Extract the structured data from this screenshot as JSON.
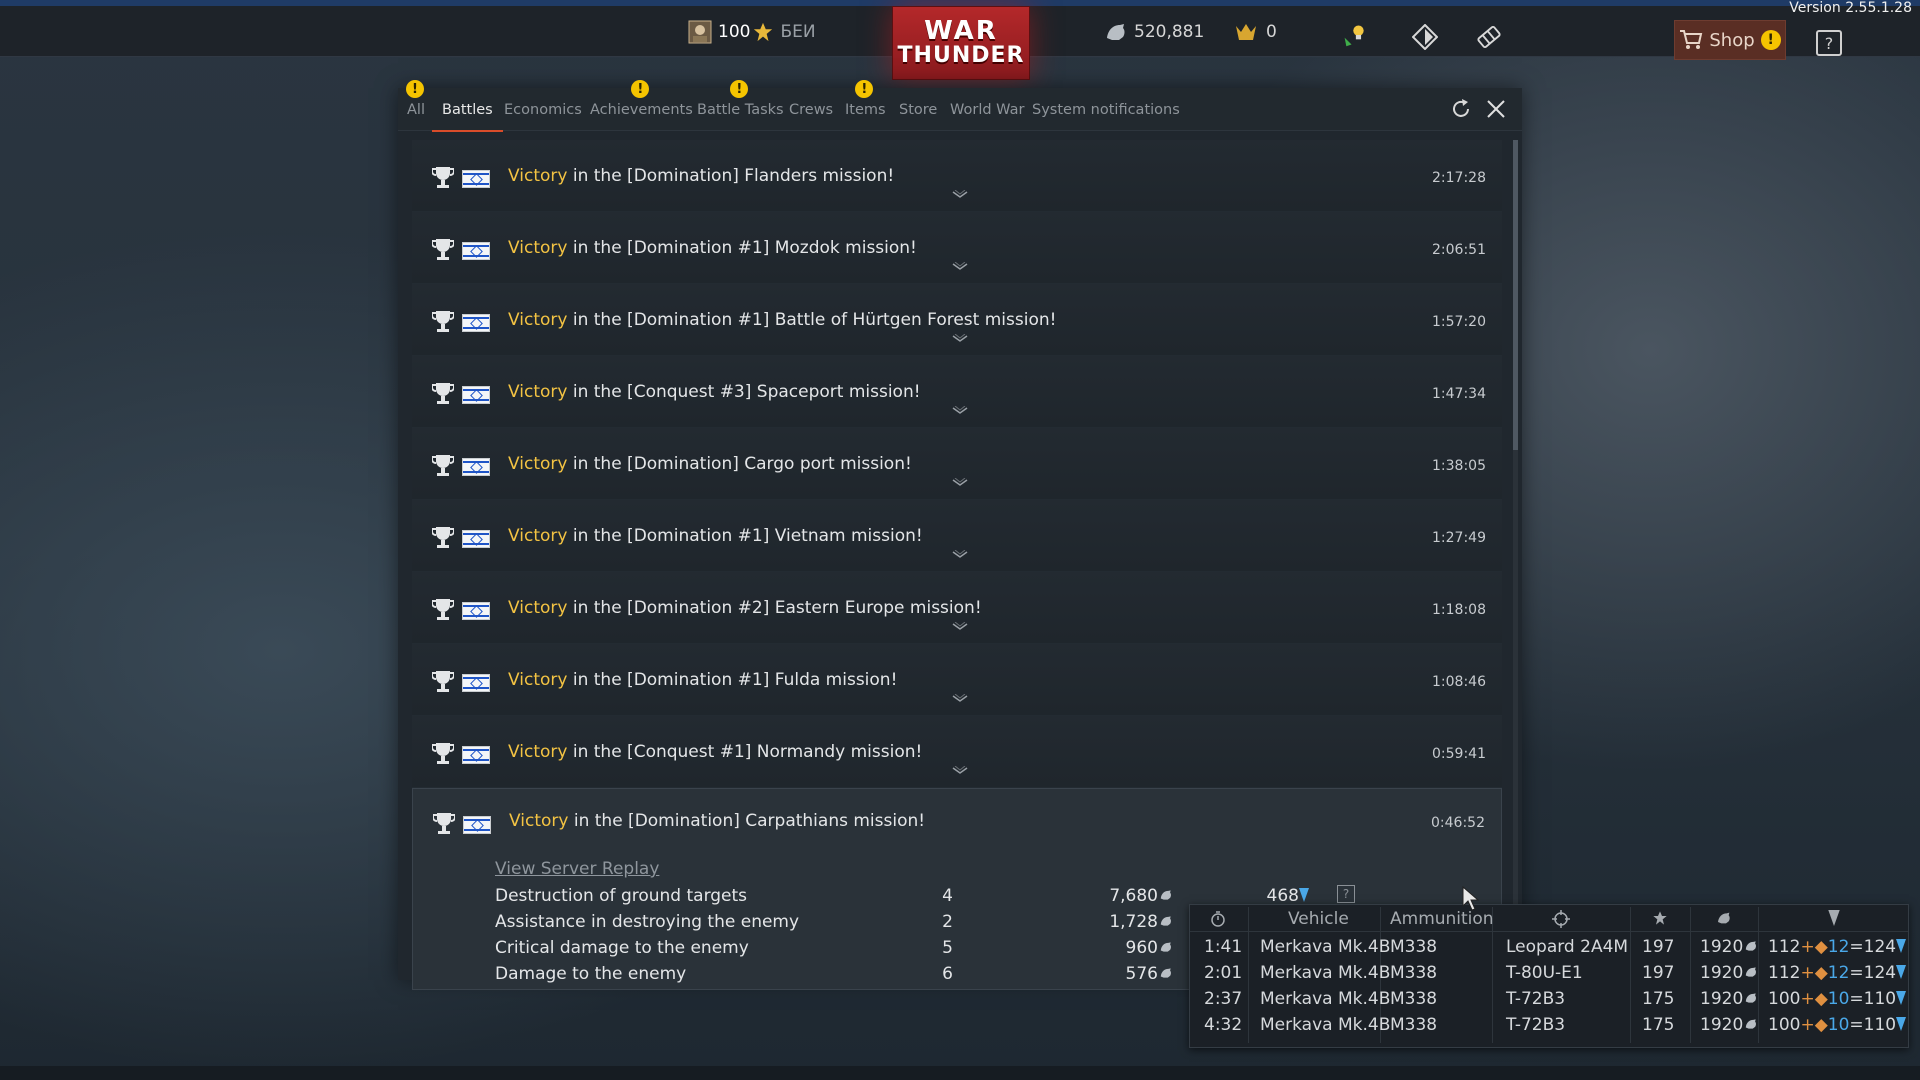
{
  "version": "Version 2.55.1.28",
  "topbar": {
    "rank": "100",
    "rank_suffix": "БЕИ",
    "logo_line1": "WAR",
    "logo_line2": "THUNDER",
    "silver_lions": "520,881",
    "golden_eagles": "0",
    "shop_label": "Shop",
    "shop_badge": "!",
    "help_label": "?"
  },
  "tabs": [
    {
      "label": "All",
      "badge": "!"
    },
    {
      "label": "Battles",
      "badge": ""
    },
    {
      "label": "Economics",
      "badge": ""
    },
    {
      "label": "Achievements",
      "badge": "!"
    },
    {
      "label": "Battle Tasks",
      "badge": "!"
    },
    {
      "label": "Crews",
      "badge": ""
    },
    {
      "label": "Items",
      "badge": "!"
    },
    {
      "label": "Store",
      "badge": ""
    },
    {
      "label": "World War",
      "badge": ""
    },
    {
      "label": "System notifications",
      "badge": ""
    }
  ],
  "battles": [
    {
      "result": "Victory",
      "text": " in the [Domination] Flanders mission!",
      "time": "2:17:28"
    },
    {
      "result": "Victory",
      "text": " in the [Domination #1] Mozdok mission!",
      "time": "2:06:51"
    },
    {
      "result": "Victory",
      "text": " in the [Domination #1] Battle of Hürtgen Forest mission!",
      "time": "1:57:20"
    },
    {
      "result": "Victory",
      "text": " in the [Conquest #3] Spaceport mission!",
      "time": "1:47:34"
    },
    {
      "result": "Victory",
      "text": " in the [Domination] Cargo port mission!",
      "time": "1:38:05"
    },
    {
      "result": "Victory",
      "text": " in the [Domination #1] Vietnam mission!",
      "time": "1:27:49"
    },
    {
      "result": "Victory",
      "text": " in the [Domination #2] Eastern Europe mission!",
      "time": "1:18:08"
    },
    {
      "result": "Victory",
      "text": " in the [Domination #1] Fulda mission!",
      "time": "1:08:46"
    },
    {
      "result": "Victory",
      "text": " in the [Conquest #1] Normandy mission!",
      "time": "0:59:41"
    }
  ],
  "expanded": {
    "result": "Victory",
    "text": " in the [Domination] Carpathians mission!",
    "time": "0:46:52",
    "replay_label": "View Server Replay",
    "stats": [
      {
        "label": "Destruction of ground targets",
        "count": "4",
        "sl": "7,680",
        "rp": "468",
        "help": "?"
      },
      {
        "label": "Assistance in destroying the enemy",
        "count": "2",
        "sl": "1,728"
      },
      {
        "label": "Critical damage to the enemy",
        "count": "5",
        "sl": "960"
      },
      {
        "label": "Damage to the enemy",
        "count": "6",
        "sl": "576"
      }
    ]
  },
  "tooltip": {
    "headers": {
      "vehicle": "Vehicle",
      "ammunition": "Ammunition"
    },
    "rows": [
      {
        "time": "1:41",
        "vehicle": "Merkava Mk.4B",
        "ammo": "M338",
        "target": "Leopard 2A4M",
        "score": "197",
        "sl": "1920",
        "rp_base": "112",
        "rp_bonus": "12",
        "rp_total": "=124"
      },
      {
        "time": "2:01",
        "vehicle": "Merkava Mk.4B",
        "ammo": "M338",
        "target": "T-80U-E1",
        "score": "197",
        "sl": "1920",
        "rp_base": "112",
        "rp_bonus": "12",
        "rp_total": "=124"
      },
      {
        "time": "2:37",
        "vehicle": "Merkava Mk.4B",
        "ammo": "M338",
        "target": "T-72B3",
        "score": "175",
        "sl": "1920",
        "rp_base": "100",
        "rp_bonus": "10",
        "rp_total": "=110"
      },
      {
        "time": "4:32",
        "vehicle": "Merkava Mk.4B",
        "ammo": "M338",
        "target": "T-72B3",
        "score": "175",
        "sl": "1920",
        "rp_base": "100",
        "rp_bonus": "10",
        "rp_total": "=110"
      }
    ]
  },
  "colors": {
    "victory": "#f3c343",
    "accent_tab": "#d84c2a",
    "rp_blue": "#4aa8e8"
  }
}
